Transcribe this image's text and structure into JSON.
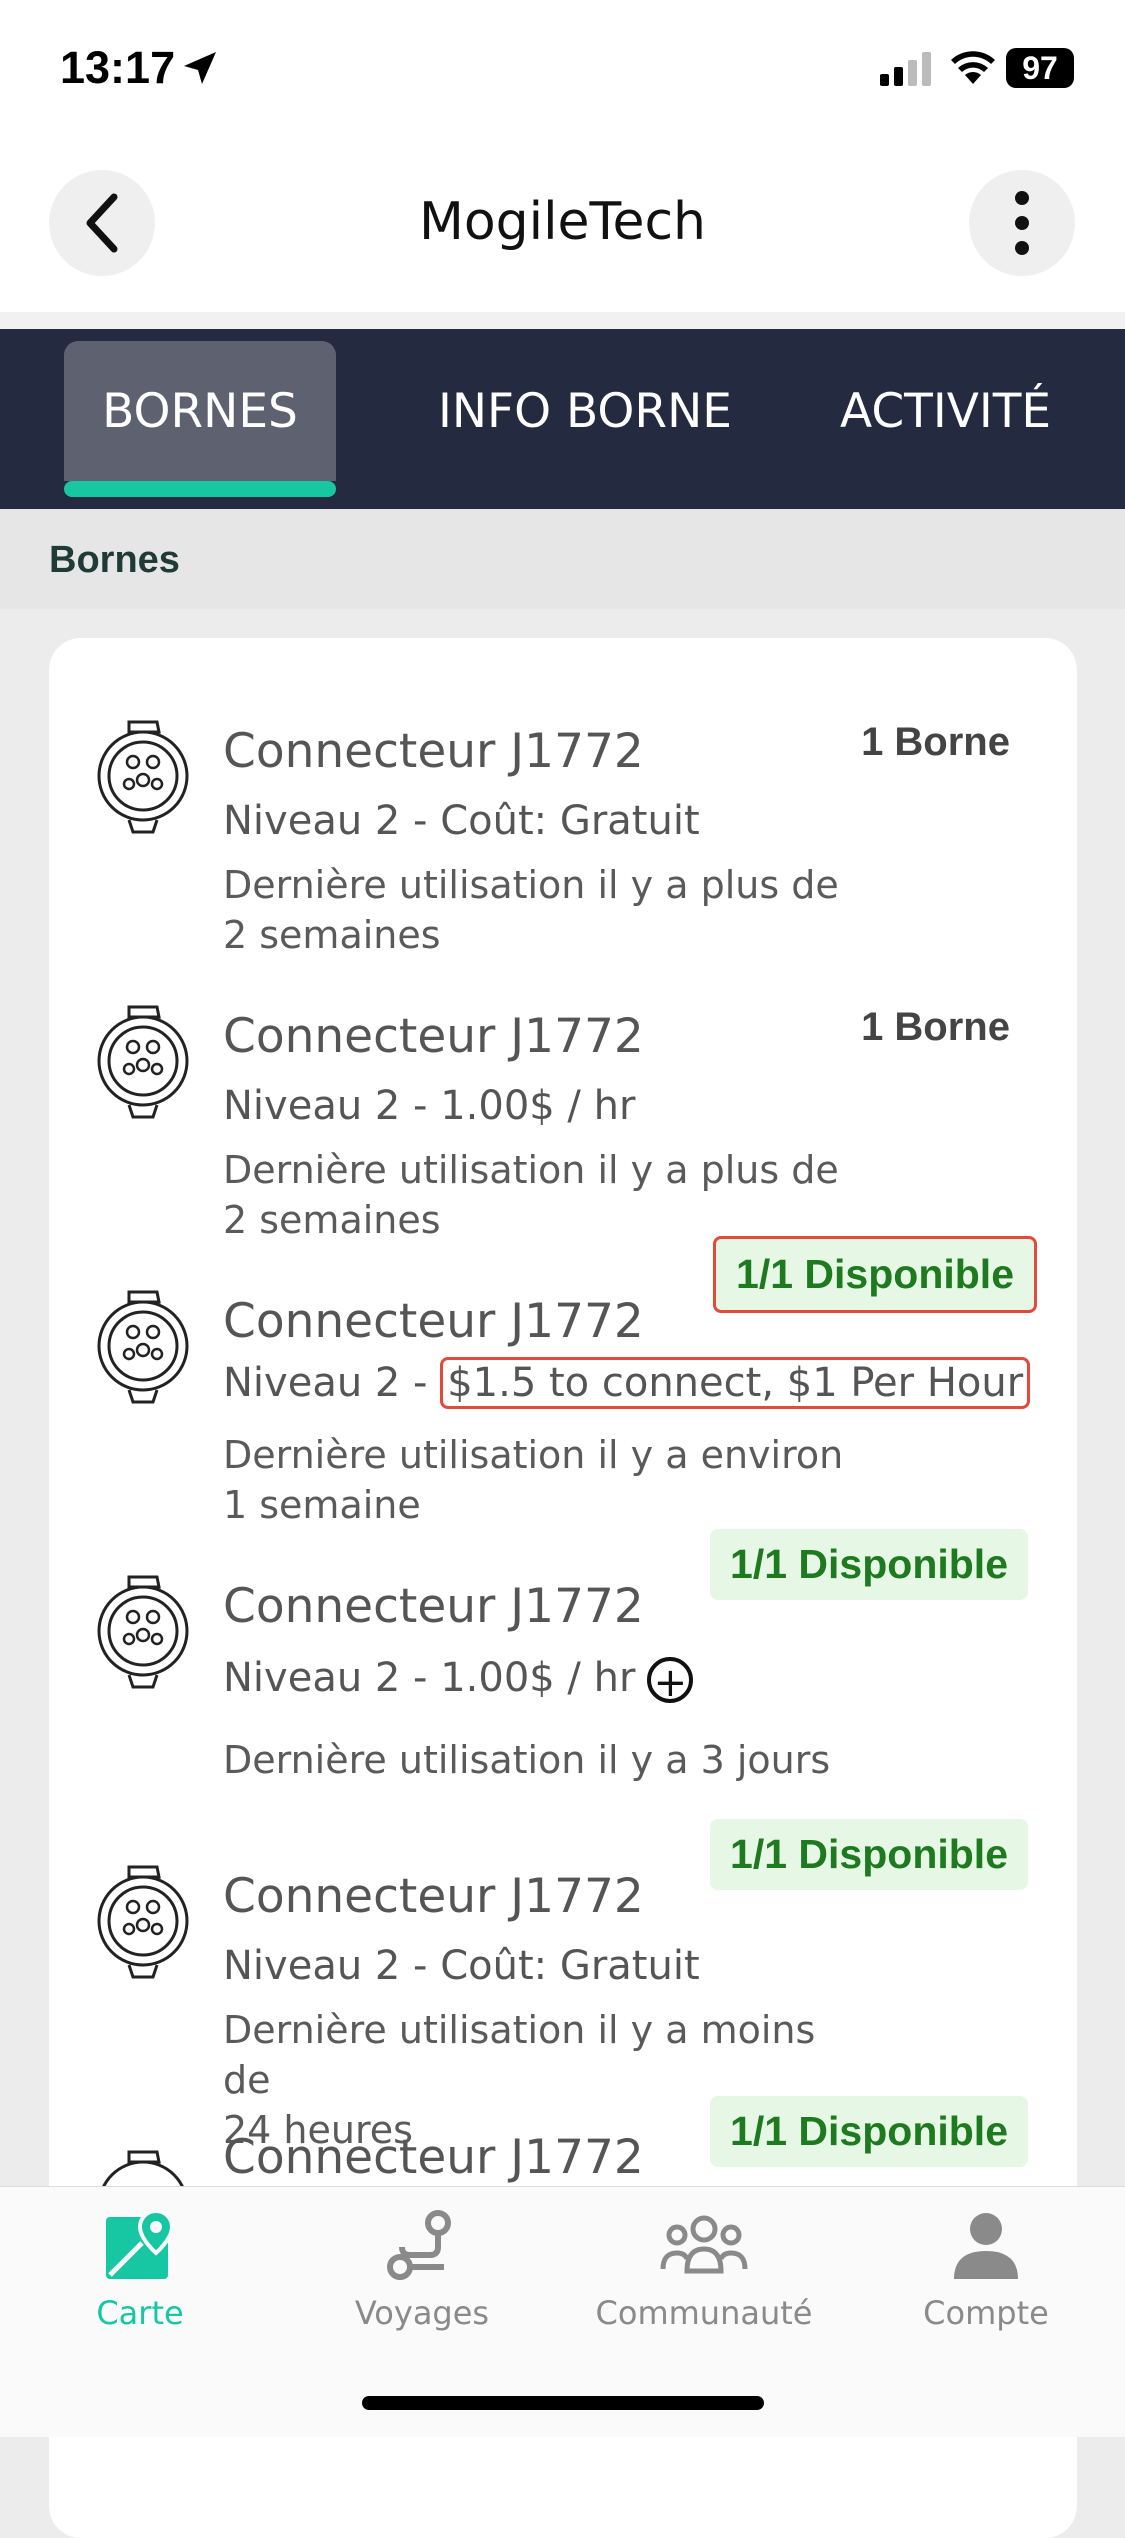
{
  "status": {
    "time": "13:17",
    "battery": "97"
  },
  "header": {
    "title": "MogileTech"
  },
  "tabs": [
    {
      "label": "BORNES",
      "active": true
    },
    {
      "label": "INFO BORNE",
      "active": false
    },
    {
      "label": "ACTIVITÉ",
      "active": false
    }
  ],
  "section": {
    "title": "Bornes"
  },
  "connectors": [
    {
      "title": "Connecteur J1772",
      "sub": "Niveau 2 - Coût: Gratuit",
      "last_line1": "Dernière utilisation il y a plus de",
      "last_line2": "2 semaines",
      "badge": "1 Borne"
    },
    {
      "title": "Connecteur J1772",
      "sub": "Niveau 2 - 1.00$ / hr",
      "last_line1": "Dernière utilisation il y a plus de",
      "last_line2": "2 semaines",
      "badge": "1 Borne"
    },
    {
      "title": "Connecteur J1772",
      "sub_prefix": "Niveau 2 - ",
      "sub_highlight": "$1.5 to connect, $1 Per Hour",
      "last_line1": "Dernière utilisation il y a environ",
      "last_line2": "1 semaine",
      "badge": "1/1 Disponible"
    },
    {
      "title": "Connecteur J1772",
      "sub": "Niveau 2 - 1.00$ / hr",
      "last_line1": "Dernière utilisation il y a 3 jours",
      "badge": "1/1 Disponible"
    },
    {
      "title": "Connecteur J1772",
      "sub": "Niveau 2 - Coût: Gratuit",
      "last_line1": "Dernière utilisation il y a moins de",
      "last_line2": "24 heures",
      "badge": "1/1 Disponible"
    },
    {
      "title": "Connecteur J1772",
      "badge": "1/1 Disponible"
    }
  ],
  "nav": [
    {
      "label": "Carte",
      "icon": "map-pin-icon",
      "active": true
    },
    {
      "label": "Voyages",
      "icon": "route-icon",
      "active": false
    },
    {
      "label": "Communauté",
      "icon": "community-icon",
      "active": false
    },
    {
      "label": "Compte",
      "icon": "account-icon",
      "active": false
    }
  ],
  "colors": {
    "accent": "#17c7a3",
    "tabbar": "#242a40",
    "available_text": "#1e7a1e",
    "highlight": "#e24b3c"
  }
}
